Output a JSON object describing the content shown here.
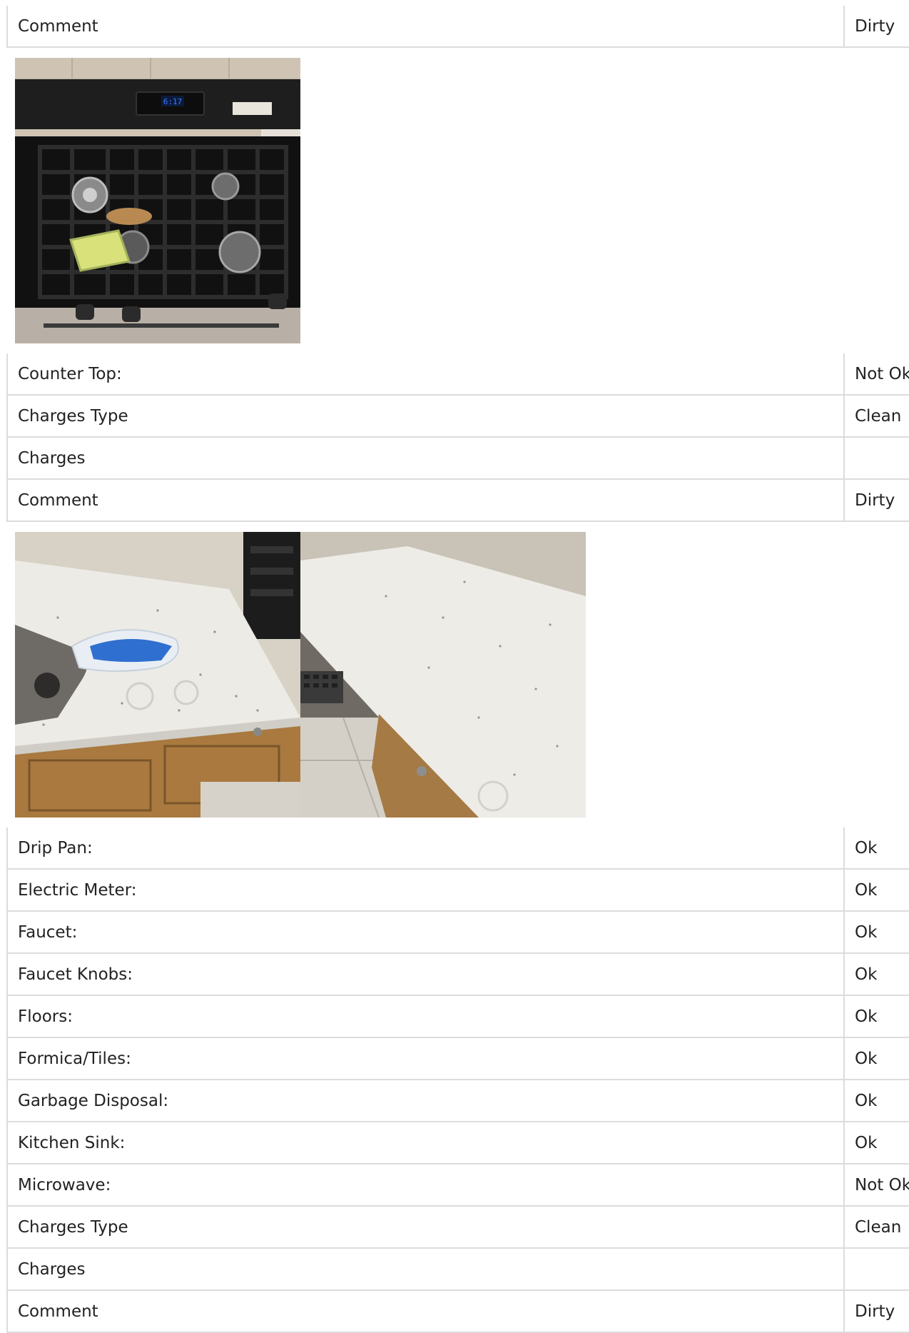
{
  "sections": [
    {
      "rows": [
        {
          "label": "Comment",
          "value": "Dirty"
        }
      ],
      "photos": [
        {
          "alt": "stove-photo"
        }
      ]
    },
    {
      "rows": [
        {
          "label": "Counter Top:",
          "value": "Not Ok"
        },
        {
          "label": "Charges Type",
          "value": "Clean"
        },
        {
          "label": "Charges",
          "value": ""
        },
        {
          "label": "Comment",
          "value": "Dirty"
        }
      ],
      "photos": [
        {
          "alt": "countertop-photo-1"
        },
        {
          "alt": "countertop-photo-2"
        }
      ]
    },
    {
      "rows": [
        {
          "label": "Drip Pan:",
          "value": "Ok"
        },
        {
          "label": "Electric Meter:",
          "value": "Ok"
        },
        {
          "label": "Faucet:",
          "value": "Ok"
        },
        {
          "label": "Faucet Knobs:",
          "value": "Ok"
        },
        {
          "label": "Floors:",
          "value": "Ok"
        },
        {
          "label": "Formica/Tiles:",
          "value": "Ok"
        },
        {
          "label": "Garbage Disposal:",
          "value": "Ok"
        },
        {
          "label": "Kitchen Sink:",
          "value": "Ok"
        },
        {
          "label": "Microwave:",
          "value": "Not Ok"
        },
        {
          "label": "Charges Type",
          "value": "Clean"
        },
        {
          "label": "Charges",
          "value": ""
        },
        {
          "label": "Comment",
          "value": "Dirty"
        }
      ]
    }
  ],
  "stove_display": "6:17"
}
